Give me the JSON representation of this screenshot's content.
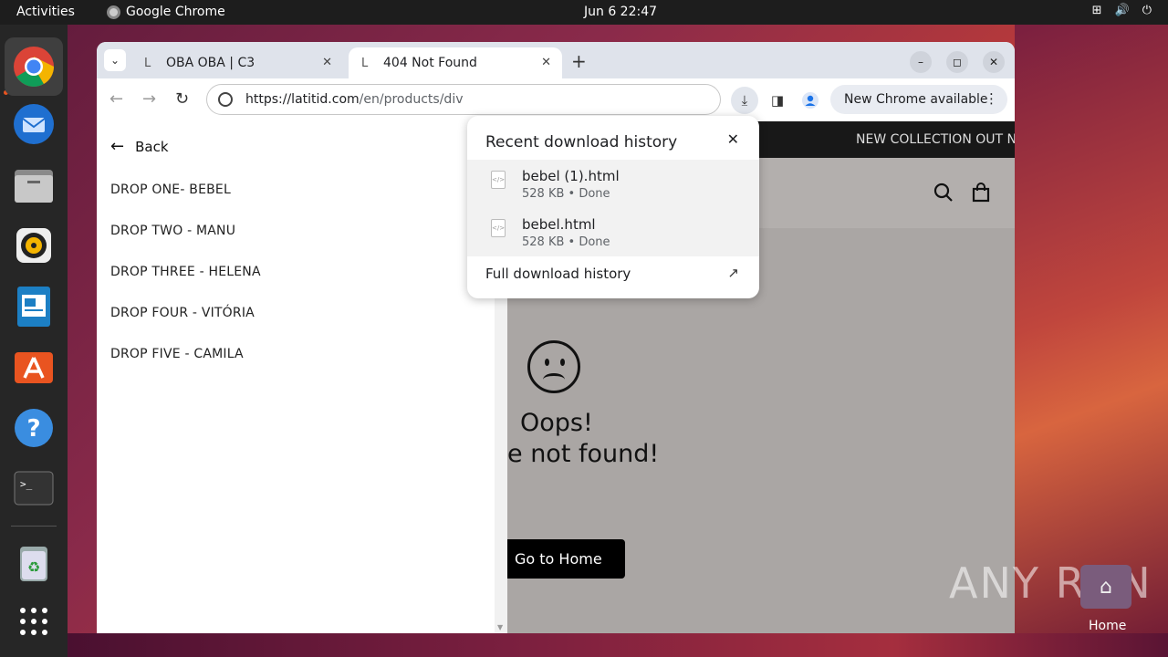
{
  "topbar": {
    "activities": "Activities",
    "app_name": "Google Chrome",
    "clock": "Jun 6  22:47"
  },
  "dock": {
    "items": [
      "chrome-icon",
      "thunderbird-icon",
      "files-icon",
      "rhythmbox-icon",
      "writer-icon",
      "app-center-icon",
      "help-icon",
      "terminal-icon",
      "trash-icon",
      "show-apps-icon"
    ]
  },
  "browser": {
    "tabs": [
      {
        "title": "OBA OBA | C3",
        "favicon": "L"
      },
      {
        "title": "404 Not Found",
        "favicon": "L"
      }
    ],
    "url_host": "https://latitid.com",
    "url_path": "/en/products/div",
    "update_label": "New Chrome available"
  },
  "sidemenu": {
    "back_label": "Back",
    "items": [
      "DROP ONE- BEBEL",
      "DROP TWO - MANU",
      "DROP THREE - HELENA",
      "DROP FOUR - VITÓRIA",
      "DROP FIVE - CAMILA"
    ]
  },
  "page": {
    "announcement": "NEW COLLECTION OUT N",
    "oops": "Oops!",
    "not_found": "e not found!",
    "home_button": "Go to Home"
  },
  "downloads": {
    "title": "Recent download history",
    "items": [
      {
        "name": "bebel (1).html",
        "meta": "528 KB • Done"
      },
      {
        "name": "bebel.html",
        "meta": "528 KB • Done"
      }
    ],
    "full_history": "Full download history"
  },
  "desktop": {
    "home_label": "Home",
    "watermark": "ANY RUN"
  }
}
